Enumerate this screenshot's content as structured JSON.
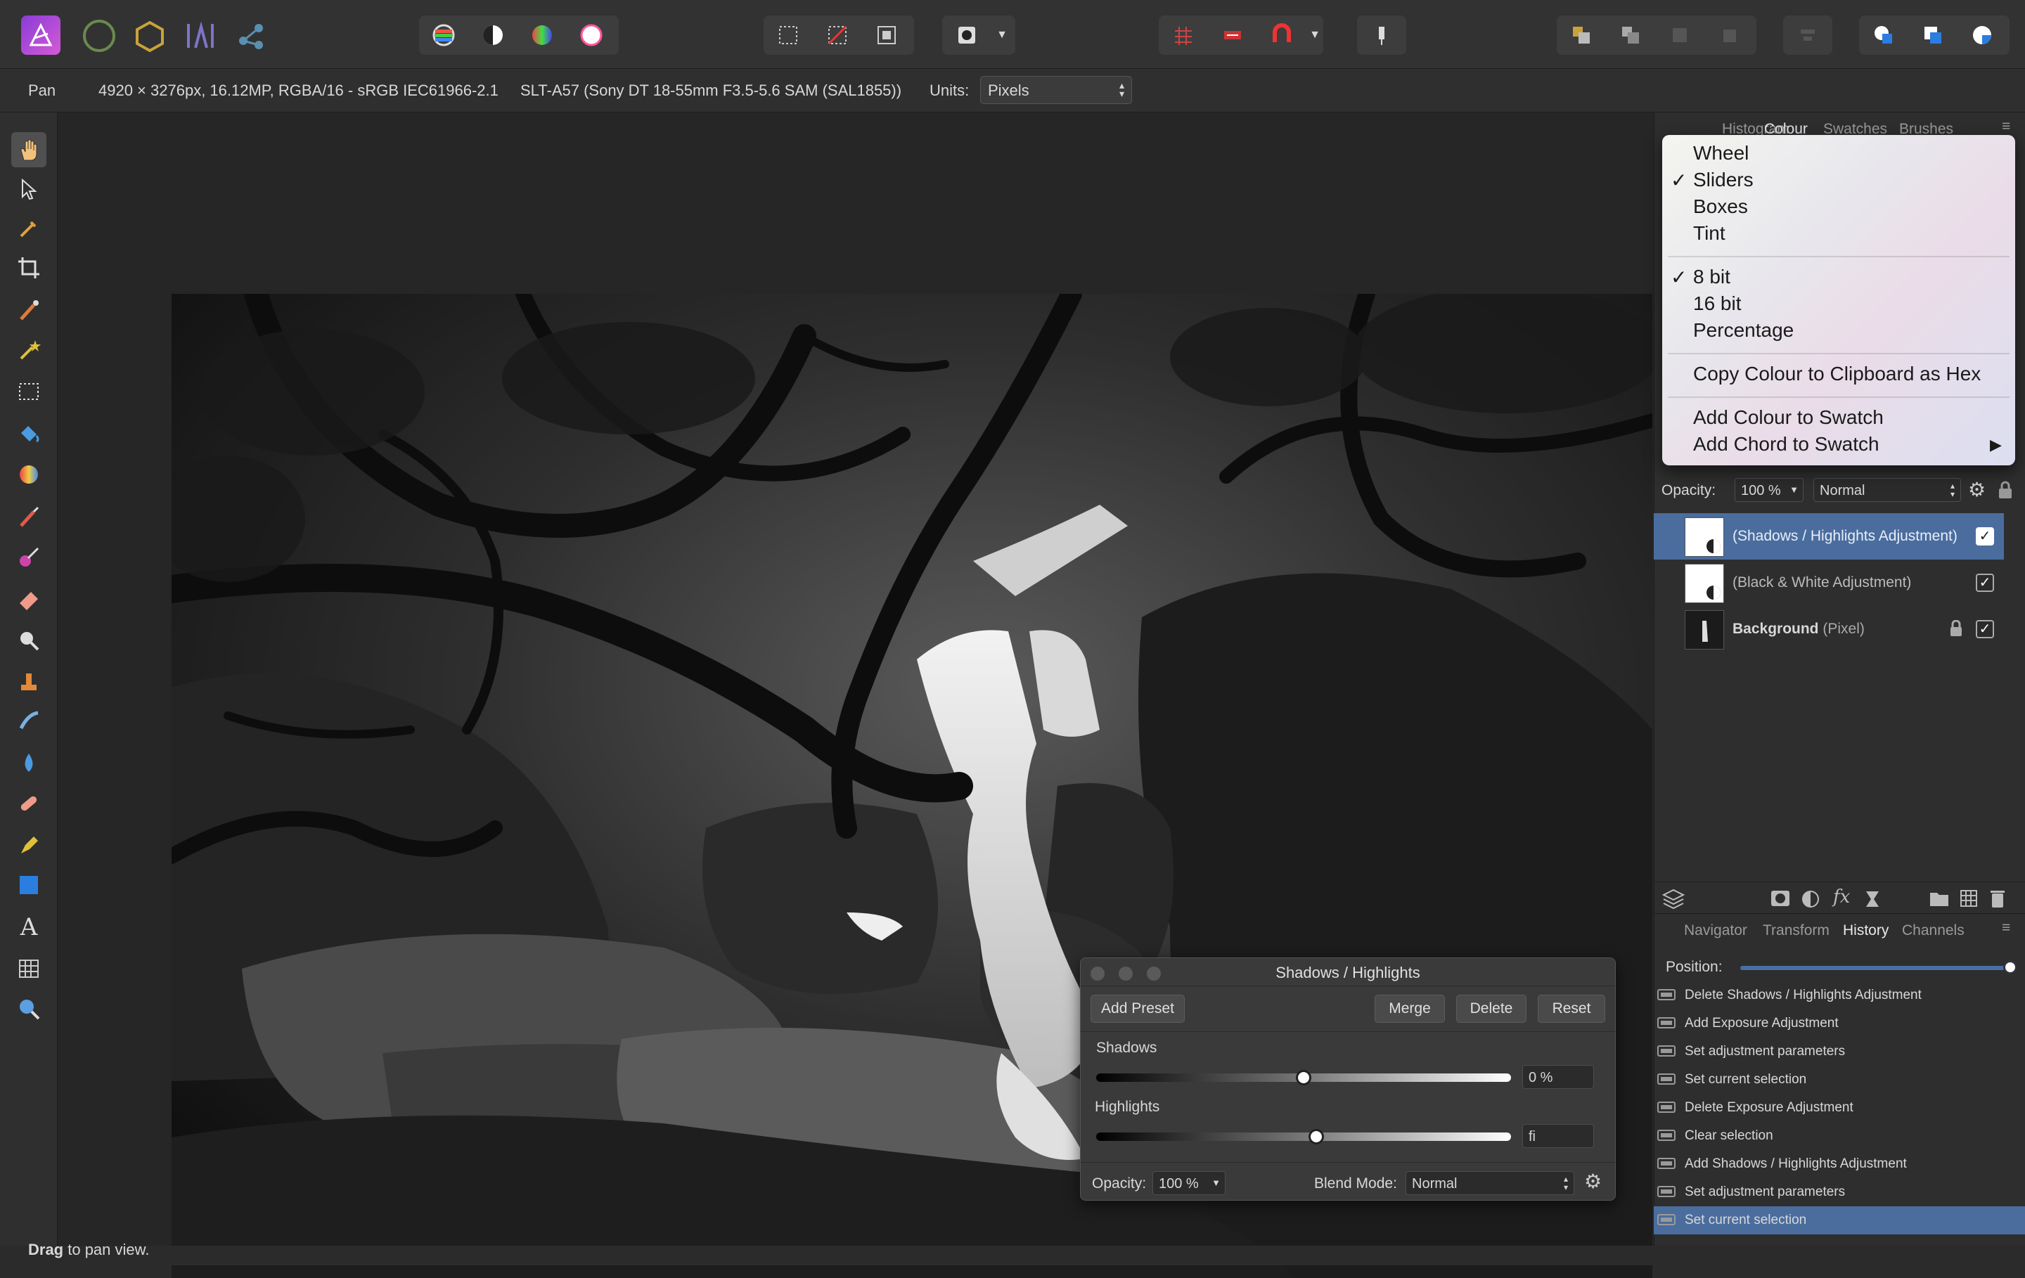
{
  "context_bar": {
    "tool": "Pan",
    "document_info": "4920 × 3276px, 16.12MP, RGBA/16 - sRGB IEC61966-2.1",
    "camera": "SLT-A57 (Sony DT 18-55mm F3.5-5.6 SAM (SAL1855))",
    "units_label": "Units:",
    "units_value": "Pixels"
  },
  "status_bar": {
    "bold": "Drag",
    "text": " to pan view."
  },
  "top_panel": {
    "tabs": [
      "Histogram",
      "Colour",
      "Swatches",
      "Brushes"
    ],
    "active_tab": "Colour"
  },
  "colour_menu": {
    "items": [
      {
        "label": "Wheel",
        "checked": ""
      },
      {
        "label": "Sliders",
        "checked": "✓"
      },
      {
        "label": "Boxes",
        "checked": ""
      },
      {
        "label": "Tint",
        "checked": ""
      },
      {
        "label": "8 bit",
        "checked": "✓"
      },
      {
        "label": "16 bit",
        "checked": ""
      },
      {
        "label": "Percentage",
        "checked": ""
      },
      {
        "label": "Copy Colour to Clipboard as Hex",
        "checked": ""
      },
      {
        "label": "Add Colour to Swatch",
        "checked": ""
      },
      {
        "label": "Add Chord to Swatch",
        "checked": "",
        "arrow": "▶"
      }
    ]
  },
  "layers_panel": {
    "opacity_label": "Opacity:",
    "opacity_value": "100 %",
    "blend_mode": "Normal",
    "layers": [
      {
        "name": "(Shadows / Highlights Adjustment)",
        "type": "",
        "selected": true
      },
      {
        "name": "(Black & White Adjustment)",
        "type": "",
        "selected": false
      },
      {
        "name": "Background",
        "type": "(Pixel)",
        "selected": false
      }
    ]
  },
  "bottom_panel": {
    "tabs": [
      "Navigator",
      "Transform",
      "History",
      "Channels"
    ],
    "active_tab": "History",
    "position_label": "Position:",
    "position_value": 1.0
  },
  "history": [
    "Delete Shadows / Highlights Adjustment",
    "Add Exposure Adjustment",
    "Set adjustment parameters",
    "Set current selection",
    "Delete Exposure Adjustment",
    "Clear selection",
    "Add Shadows / Highlights Adjustment",
    "Set adjustment parameters",
    "Set current selection"
  ],
  "dialog": {
    "title": "Shadows / Highlights",
    "add_preset": "Add Preset",
    "merge": "Merge",
    "delete": "Delete",
    "reset": "Reset",
    "shadows_label": "Shadows",
    "shadows_value": "0 %",
    "shadows_level": 0.5,
    "highlights_label": "Highlights",
    "highlights_value": "fi",
    "highlights_level": 0.53,
    "opacity_label": "Opacity:",
    "opacity_value": "100 %",
    "blend_label": "Blend Mode:",
    "blend_value": "Normal"
  },
  "colors": {
    "accent": "#4b6ea6",
    "selected_row": "#4a6d9e"
  }
}
